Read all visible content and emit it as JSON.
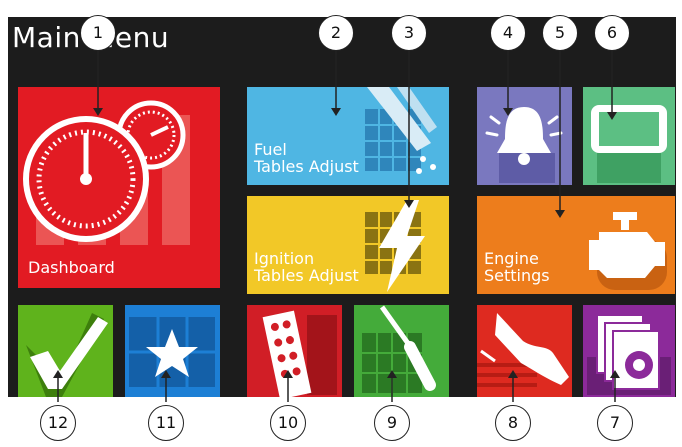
{
  "screen": {
    "title": "Main Menu"
  },
  "tiles": {
    "dashboard": {
      "label": "Dashboard",
      "color": "#e21b23",
      "icon": "gauge-icon"
    },
    "fuel": {
      "label": "Fuel\nTables Adjust",
      "color": "#4fb6e3",
      "icon": "fuel-injector-icon"
    },
    "ignition": {
      "label": "Ignition\nTables Adjust",
      "color": "#f2c827",
      "icon": "lightning-bolt-icon"
    },
    "alarms": {
      "label": "",
      "color": "#7a78bf",
      "icon": "bell-icon"
    },
    "display": {
      "label": "",
      "color": "#5cbf83",
      "icon": "display-icon"
    },
    "engine": {
      "label": "Engine\nSettings",
      "color": "#ed7d1c",
      "icon": "engine-icon"
    },
    "check": {
      "label": "",
      "color": "#5fb31c",
      "icon": "checkmark-icon"
    },
    "favorites": {
      "label": "",
      "color": "#1d7fd5",
      "icon": "star-icon"
    },
    "ignition_timing": {
      "label": "",
      "color": "#d11e26",
      "icon": "distributor-icon"
    },
    "tools": {
      "label": "",
      "color": "#44ab3a",
      "icon": "screwdriver-icon"
    },
    "launch": {
      "label": "",
      "color": "#de2a20",
      "icon": "shoe-icon"
    },
    "files": {
      "label": "",
      "color": "#8c2a9a",
      "icon": "settings-files-icon"
    }
  },
  "callouts": [
    "1",
    "2",
    "3",
    "4",
    "5",
    "6",
    "7",
    "8",
    "9",
    "10",
    "11",
    "12"
  ]
}
